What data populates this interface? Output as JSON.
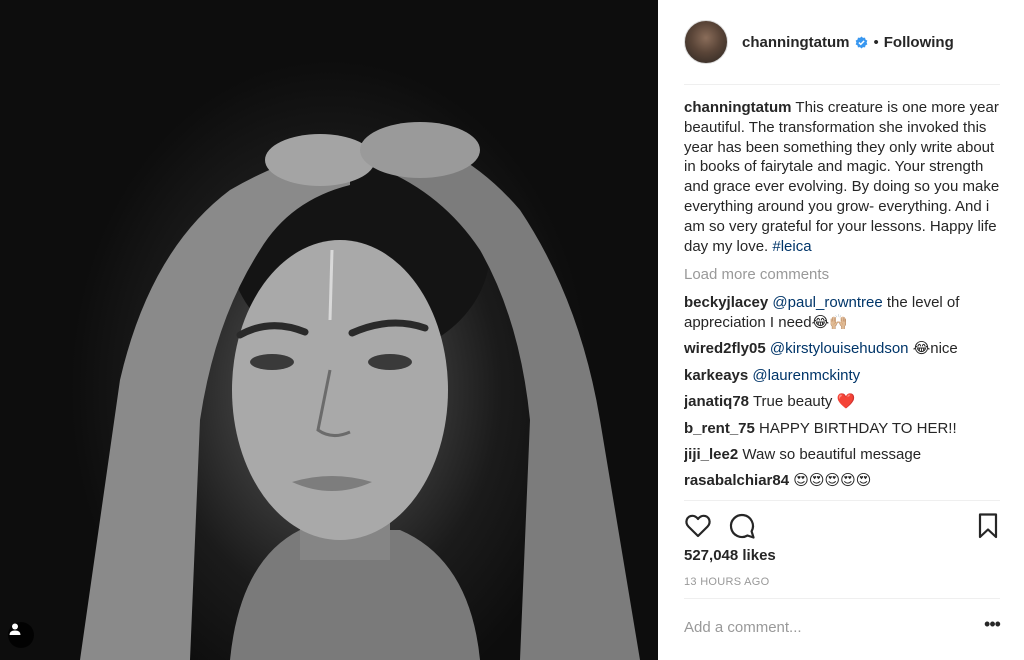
{
  "post": {
    "username": "channingtatum",
    "follow_label": "Following",
    "separator": "•",
    "caption": "This creature is one more year beautiful. The transformation she invoked this year has been something they only write about in books of fairytale and magic. Your strength and grace ever evolving. By doing so you make everything around you grow- everything. And i am so very grateful for your lessons. Happy life day my love.",
    "hashtag": "#leica",
    "load_more": "Load more comments",
    "comments": [
      {
        "user": "beckyjlacey",
        "mention": "@paul_rowntree",
        "text": "the level of appreciation I need",
        "emoji": "😂🙌🏼"
      },
      {
        "user": "wired2fly05",
        "mention": "@kirstylouisehudson",
        "emoji": "😂",
        "text": "nice"
      },
      {
        "user": "karkeays",
        "mention": "@laurenmckinty",
        "text": ""
      },
      {
        "user": "janatiq78",
        "text": "True beauty",
        "emoji": "❤️"
      },
      {
        "user": "b_rent_75",
        "text": "HAPPY BIRTHDAY TO HER!!"
      },
      {
        "user": "jiji_lee2",
        "text": "Waw so beautiful message"
      },
      {
        "user": "rasabalchiar84",
        "text": "",
        "emoji": "😍😍😍😍😍"
      }
    ],
    "likes": "527,048 likes",
    "time": "13 HOURS AGO",
    "add_comment_placeholder": "Add a comment...",
    "more_label": "•••"
  },
  "icons": {
    "heart": "heart-icon",
    "comment": "comment-icon",
    "bookmark": "bookmark-icon",
    "verified": "verified-badge-icon",
    "user_tag": "user-tag-icon"
  },
  "colors": {
    "verified": "#3897f0",
    "link": "#003569",
    "muted": "#999999",
    "heart": "#ed4956"
  }
}
